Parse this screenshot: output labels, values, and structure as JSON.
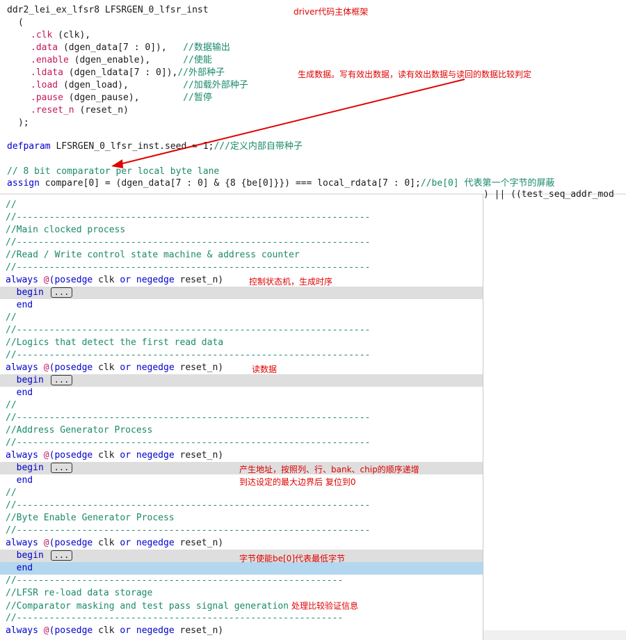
{
  "top_code": {
    "inst_line": "ddr2_lei_ex_lfsr8 LFSRGEN_0_lfsr_inst",
    "open_paren": "(",
    "ports": [
      {
        "name": ".clk",
        "arg": " (clk),",
        "comment": ""
      },
      {
        "name": ".data",
        "arg": " (dgen_data[7 : 0]),",
        "comment": "   //数据输出"
      },
      {
        "name": ".enable",
        "arg": " (dgen_enable),",
        "comment": "      //使能"
      },
      {
        "name": ".ldata",
        "arg": " (dgen_ldata[7 : 0]),",
        "comment": "//外部种子"
      },
      {
        "name": ".load",
        "arg": " (dgen_load),",
        "comment": "          //加载外部种子"
      },
      {
        "name": ".pause",
        "arg": " (dgen_pause),",
        "comment": "        //暂停"
      },
      {
        "name": ".reset_n",
        "arg": " (reset_n)",
        "comment": ""
      }
    ],
    "close_paren": ");",
    "defparam_kw": "defparam",
    "defparam_body": " LFSRGEN_0_lfsr_inst.seed = 1;",
    "defparam_comment": "///定义内部自带种子",
    "comparator_comment": "// 8 bit comparator per local byte lane",
    "assign_kw": "assign",
    "assign_body": " compare[0] = (dgen_data[7 : 0] & {8 {be[0]}}) === local_rdata[7 : 0];",
    "assign_comment": "//be[0] 代表第一个字节的屏蔽"
  },
  "annotations": {
    "driver_frame": "driver代码主体框架",
    "gen_data": "生成数据。写有效出数据，读有效出数据与读回的数据比较判定",
    "state_machine": "控制状态机，生成时序",
    "read_data": "读数据",
    "addr_gen_1": "产生地址，按照列、行、bank、chip的顺序递增",
    "addr_gen_2": "到达设定的最大边界后 复位到0",
    "byte_enable": "字节使能be[0]代表最低字节",
    "compare_verify": "处理比较验证信息"
  },
  "right_pane": {
    "partial_line": ") || ((test_seq_addr_mod"
  },
  "bottom_code": {
    "slashes": "//",
    "dash_line": "//-----------------------------------------------------------------",
    "dash_line_short": "//------------------------------------------------------------",
    "main_clocked": "//Main clocked process",
    "rw_control": "//Read / Write control state machine & address counter",
    "logic_detect": "//Logics that detect the first read data",
    "addr_gen": "//Address Generator Process",
    "byte_enable": "//Byte Enable Generator Process",
    "lfsr_reload": "//LFSR re-load data storage",
    "comparator_mask": "//Comparator masking and test pass signal generation",
    "always_kw": "always",
    "at": " @",
    "posedge": "(posedge",
    "clk": " clk ",
    "or_kw": "or",
    "negedge": " negedge",
    "reset": " reset_n)",
    "begin": "  begin",
    "end": "  end",
    "fold": "..."
  }
}
